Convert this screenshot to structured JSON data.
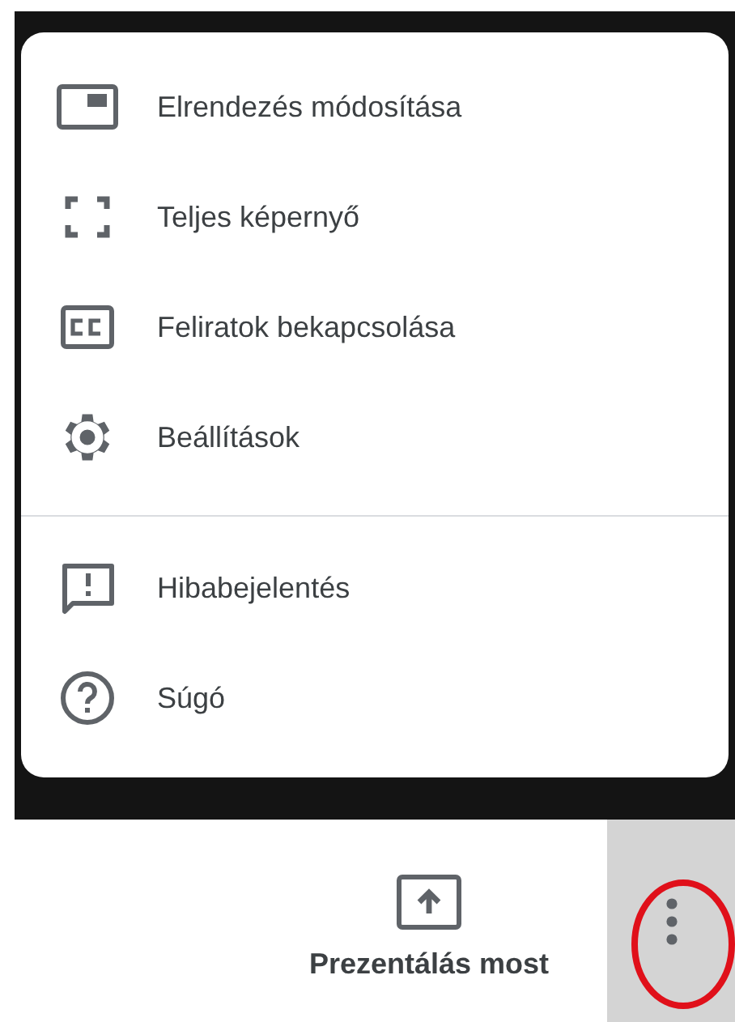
{
  "menu": {
    "sections": [
      {
        "items": [
          {
            "kind": "layout",
            "label": "Elrendezés módosítása"
          },
          {
            "kind": "fullscreen",
            "label": "Teljes képernyő"
          },
          {
            "kind": "captions",
            "label": "Feliratok bekapcsolása"
          },
          {
            "kind": "settings",
            "label": "Beállítások"
          }
        ]
      },
      {
        "items": [
          {
            "kind": "feedback",
            "label": "Hibabejelentés"
          },
          {
            "kind": "help",
            "label": "Súgó"
          }
        ]
      }
    ]
  },
  "toolbar": {
    "present_button": {
      "label": "Prezentálás most"
    },
    "more_button": {
      "highlighted": true
    }
  }
}
